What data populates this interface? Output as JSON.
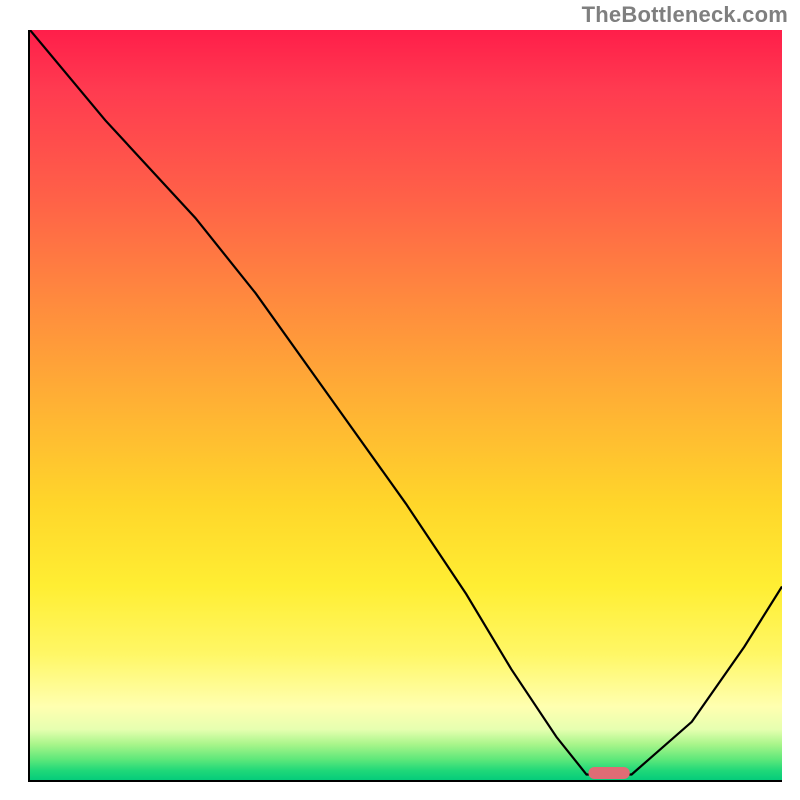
{
  "watermark": {
    "text": "TheBottleneck.com"
  },
  "chart_data": {
    "type": "line",
    "title": "",
    "xlabel": "",
    "ylabel": "",
    "xlim": [
      0,
      100
    ],
    "ylim": [
      0,
      100
    ],
    "series": [
      {
        "name": "bottleneck-curve",
        "x": [
          0,
          10,
          22,
          30,
          40,
          50,
          58,
          64,
          70,
          74,
          80,
          88,
          95,
          100
        ],
        "y": [
          100,
          88,
          75,
          65,
          51,
          37,
          25,
          15,
          6,
          1,
          1,
          8,
          18,
          26
        ]
      }
    ],
    "marker": {
      "name": "optimal-point",
      "x": 77,
      "y": 1,
      "width_pct": 5.5,
      "color": "#e06c75"
    },
    "background": {
      "type": "vertical-gradient",
      "stops": [
        {
          "pct": 0,
          "color": "#ff1e4a"
        },
        {
          "pct": 50,
          "color": "#ffb234"
        },
        {
          "pct": 83,
          "color": "#fff766"
        },
        {
          "pct": 95,
          "color": "#a8f58a"
        },
        {
          "pct": 100,
          "color": "#00c97a"
        }
      ]
    }
  }
}
